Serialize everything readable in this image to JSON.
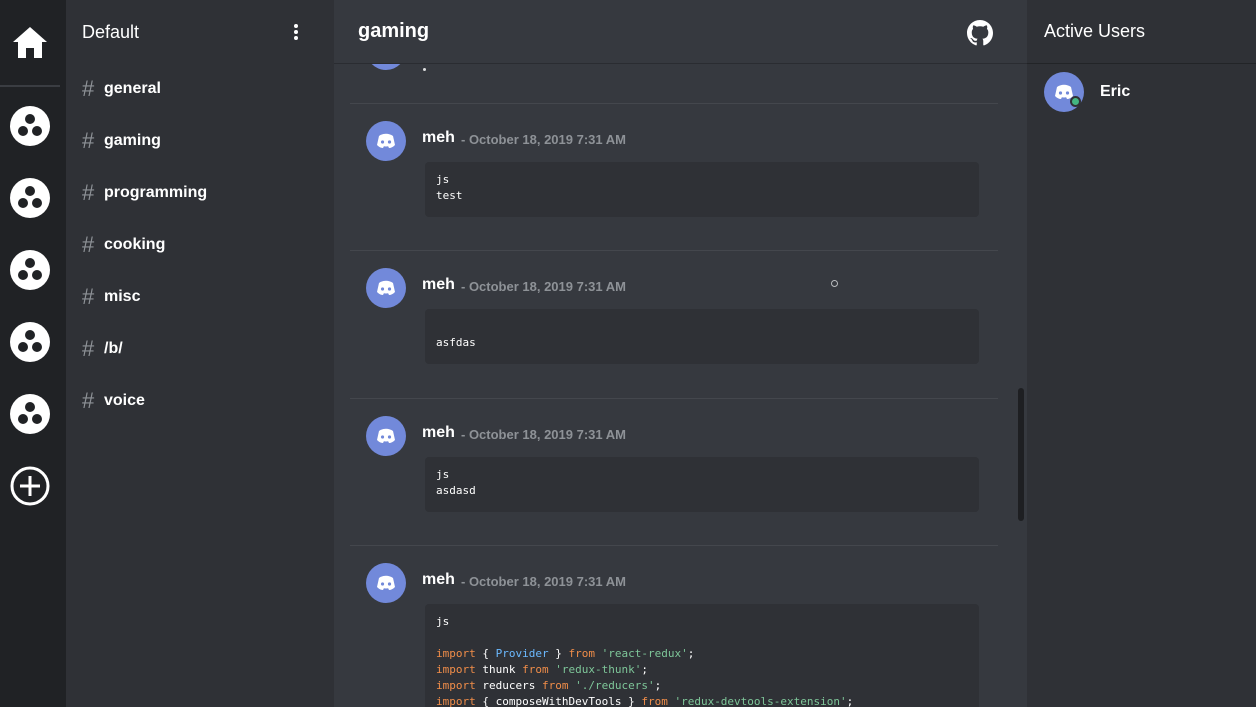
{
  "server_rail": {
    "servers": [
      "server-1",
      "server-2",
      "server-3",
      "server-4",
      "server-5"
    ]
  },
  "sidebar": {
    "server_name": "Default",
    "channels": [
      {
        "hash": "#",
        "name": "general"
      },
      {
        "hash": "#",
        "name": "gaming"
      },
      {
        "hash": "#",
        "name": "programming"
      },
      {
        "hash": "#",
        "name": "cooking"
      },
      {
        "hash": "#",
        "name": "misc"
      },
      {
        "hash": "#",
        "name": "/b/"
      },
      {
        "hash": "#",
        "name": "voice"
      }
    ]
  },
  "main": {
    "channel_title": "gaming",
    "messages": [
      {
        "author": "meh",
        "time": "- October 18, 2019 7:31 AM",
        "lines": [
          "js",
          "test"
        ]
      },
      {
        "author": "meh",
        "time": "- October 18, 2019 7:31 AM",
        "lines": [
          "",
          "asfdas"
        ]
      },
      {
        "author": "meh",
        "time": "- October 18, 2019 7:31 AM",
        "lines": [
          "js",
          "asdasd"
        ]
      },
      {
        "author": "meh",
        "time": "- October 18, 2019 7:31 AM",
        "lines": [
          "js",
          "",
          "import { Provider } from 'react-redux';",
          "import thunk from 'redux-thunk';",
          "import reducers from './reducers';",
          "import { composeWithDevTools } from 'redux-devtools-extension';"
        ]
      }
    ]
  },
  "users_panel": {
    "title": "Active Users",
    "users": [
      {
        "name": "Eric",
        "status": "online"
      }
    ]
  },
  "colors": {
    "accent": "#7289da",
    "online": "#43b581",
    "keyword": "#f08d49",
    "class": "#6bb9ff",
    "string": "#7ec699"
  },
  "icons": {
    "home": "home-icon",
    "add": "add-server-icon",
    "menu": "kebab-menu-icon",
    "github": "github-icon",
    "avatar": "discord-avatar-icon"
  }
}
